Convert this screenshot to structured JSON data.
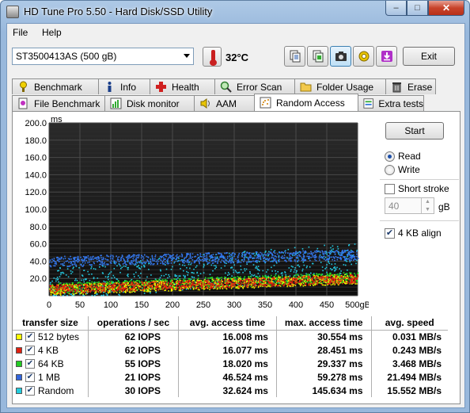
{
  "window": {
    "title": "HD Tune Pro 5.50 - Hard Disk/SSD Utility",
    "controls": {
      "minimize": "–",
      "maximize": "□",
      "close": "✕"
    }
  },
  "menu": {
    "file": "File",
    "help": "Help"
  },
  "toolbar": {
    "drive": "ST3500413AS (500 gB)",
    "temperature": "32",
    "temperature_unit": "°C",
    "exit_label": "Exit",
    "buttons": [
      "copy-text-icon",
      "copy-info-icon",
      "screenshot-icon",
      "settings-icon",
      "save-icon"
    ]
  },
  "tabs_top": [
    {
      "label": "Benchmark",
      "icon": "benchmark-icon"
    },
    {
      "label": "Info",
      "icon": "info-icon"
    },
    {
      "label": "Health",
      "icon": "health-icon"
    },
    {
      "label": "Error Scan",
      "icon": "error-scan-icon"
    },
    {
      "label": "Folder Usage",
      "icon": "folder-icon"
    },
    {
      "label": "Erase",
      "icon": "erase-icon"
    }
  ],
  "tabs_bottom": [
    {
      "label": "File Benchmark",
      "icon": "file-benchmark-icon"
    },
    {
      "label": "Disk monitor",
      "icon": "disk-monitor-icon"
    },
    {
      "label": "AAM",
      "icon": "aam-icon"
    },
    {
      "label": "Random Access",
      "icon": "random-access-icon",
      "active": true
    },
    {
      "label": "Extra tests",
      "icon": "extra-tests-icon"
    }
  ],
  "controls": {
    "start_label": "Start",
    "read_label": "Read",
    "write_label": "Write",
    "mode": "read",
    "short_stroke_label": "Short stroke",
    "short_stroke_checked": false,
    "short_stroke_value": "40",
    "short_stroke_unit": "gB",
    "align_label": "4 KB align",
    "align_checked": true
  },
  "chart_data": {
    "type": "scatter",
    "ylabel": "ms",
    "ylim": [
      0,
      200
    ],
    "xlim": [
      0,
      500
    ],
    "yticks": [
      "200.0",
      "180.0",
      "160.0",
      "140.0",
      "120.0",
      "100.0",
      "80.0",
      "60.0",
      "40.0",
      "20.0"
    ],
    "xticks": [
      "0",
      "50",
      "100",
      "150",
      "200",
      "250",
      "300",
      "350",
      "400",
      "450",
      "500gB"
    ],
    "grid": true,
    "background": "#1c1c1c",
    "series": [
      {
        "name": "512 bytes",
        "color": "#f2f200",
        "y_start": 7,
        "y_end": 20,
        "spread": 6
      },
      {
        "name": "4 KB",
        "color": "#e02010",
        "y_start": 8,
        "y_end": 20,
        "spread": 5
      },
      {
        "name": "64 KB",
        "color": "#22dd22",
        "y_start": 9,
        "y_end": 22,
        "spread": 6
      },
      {
        "name": "1 MB",
        "color": "#3377ee",
        "y_start": 40,
        "y_end": 48,
        "spread": 6
      },
      {
        "name": "Random",
        "color": "#22c8e0",
        "y_start": 15,
        "y_end": 42,
        "spread": 20
      }
    ]
  },
  "results": {
    "headers": [
      "transfer size",
      "operations / sec",
      "avg. access time",
      "max. access time",
      "avg. speed"
    ],
    "rows": [
      {
        "label": "512 bytes",
        "color": "#ffff00",
        "checked": true,
        "ops": "62 IOPS",
        "avg": "16.008 ms",
        "max": "30.554 ms",
        "speed": "0.031 MB/s"
      },
      {
        "label": "4 KB",
        "color": "#e02010",
        "checked": true,
        "ops": "62 IOPS",
        "avg": "16.077 ms",
        "max": "28.451 ms",
        "speed": "0.243 MB/s"
      },
      {
        "label": "64 KB",
        "color": "#22cc22",
        "checked": true,
        "ops": "55 IOPS",
        "avg": "18.020 ms",
        "max": "29.337 ms",
        "speed": "3.468 MB/s"
      },
      {
        "label": "1 MB",
        "color": "#3366dd",
        "checked": true,
        "ops": "21 IOPS",
        "avg": "46.524 ms",
        "max": "59.278 ms",
        "speed": "21.494 MB/s"
      },
      {
        "label": "Random",
        "color": "#22ccdd",
        "checked": true,
        "ops": "30 IOPS",
        "avg": "32.624 ms",
        "max": "145.634 ms",
        "speed": "15.552 MB/s"
      }
    ]
  }
}
